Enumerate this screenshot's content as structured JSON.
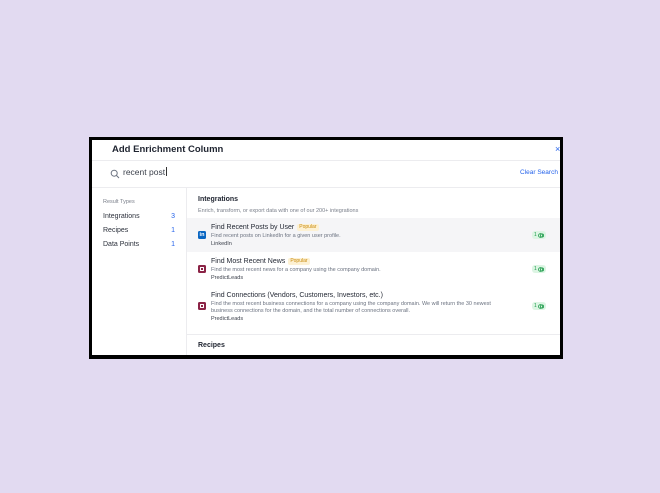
{
  "modal": {
    "title": "Add Enrichment Column",
    "close_glyph": "×"
  },
  "search": {
    "value": "recent post",
    "clear_label": "Clear Search"
  },
  "sidebar": {
    "heading": "Result Types",
    "items": [
      {
        "label": "Integrations",
        "count": "3"
      },
      {
        "label": "Recipes",
        "count": "1"
      },
      {
        "label": "Data Points",
        "count": "1"
      }
    ]
  },
  "integrations": {
    "title": "Integrations",
    "subtitle": "Enrich, transform, or export data with one of our 200+ integrations",
    "items": [
      {
        "title": "Find Recent Posts by User",
        "badge": "Popular",
        "description": "Find recent posts on LinkedIn for a given user profile.",
        "provider": "LinkedIn",
        "icon": "linkedin-icon",
        "credits": "1"
      },
      {
        "title": "Find Most Recent News",
        "badge": "Popular",
        "description": "Find the most recent news for a company using the company domain.",
        "provider": "PredictLeads",
        "icon": "predictleads-icon",
        "credits": "1"
      },
      {
        "title": "Find Connections (Vendors, Customers, Investors, etc.)",
        "description_line1": "Find the most recent business connections for a company using the company domain. We will return the 30 newest",
        "description_line2": "business connections for the domain, and the total number of connections overall.",
        "provider": "PredictLeads",
        "icon": "predictleads-icon",
        "credits": "1"
      }
    ]
  },
  "recipes": {
    "title": "Recipes"
  },
  "colors": {
    "background": "#e2daf1",
    "accent": "#2563eb",
    "badge": "#c98a0b",
    "credit": "#1e9b4b",
    "linkedin": "#0a66c2",
    "predictleads": "#8b2346"
  }
}
